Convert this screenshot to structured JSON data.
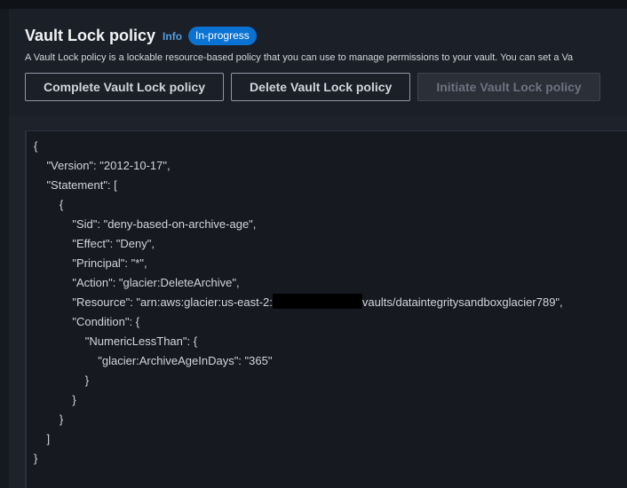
{
  "header": {
    "title": "Vault Lock policy",
    "info_label": "Info",
    "status_badge": "In-progress",
    "description": "A Vault Lock policy is a lockable resource-based policy that you can use to manage permissions to your vault. You can set a Va"
  },
  "buttons": {
    "complete": "Complete Vault Lock policy",
    "delete": "Delete Vault Lock policy",
    "initiate": "Initiate Vault Lock policy",
    "initiate_disabled": true
  },
  "policy": {
    "lines": [
      "{",
      "    \"Version\": \"2012-10-17\",",
      "    \"Statement\": [",
      "        {",
      "            \"Sid\": \"deny-based-on-archive-age\",",
      "            \"Effect\": \"Deny\",",
      "            \"Principal\": \"*\",",
      "            \"Action\": \"glacier:DeleteArchive\",",
      "            \"Resource\": \"arn:aws:glacier:us-east-2:",
      "            \"Condition\": {",
      "                \"NumericLessThan\": {",
      "                    \"glacier:ArchiveAgeInDays\": \"365\"",
      "                }",
      "            }",
      "        }",
      "    ]",
      "}"
    ],
    "resource_suffix": "vaults/dataintegritysandboxglacier789\","
  },
  "colors": {
    "background": "#16191f",
    "panel": "#1d222b",
    "badge": "#0972d3",
    "link": "#539fe5",
    "redaction": "#000000"
  }
}
